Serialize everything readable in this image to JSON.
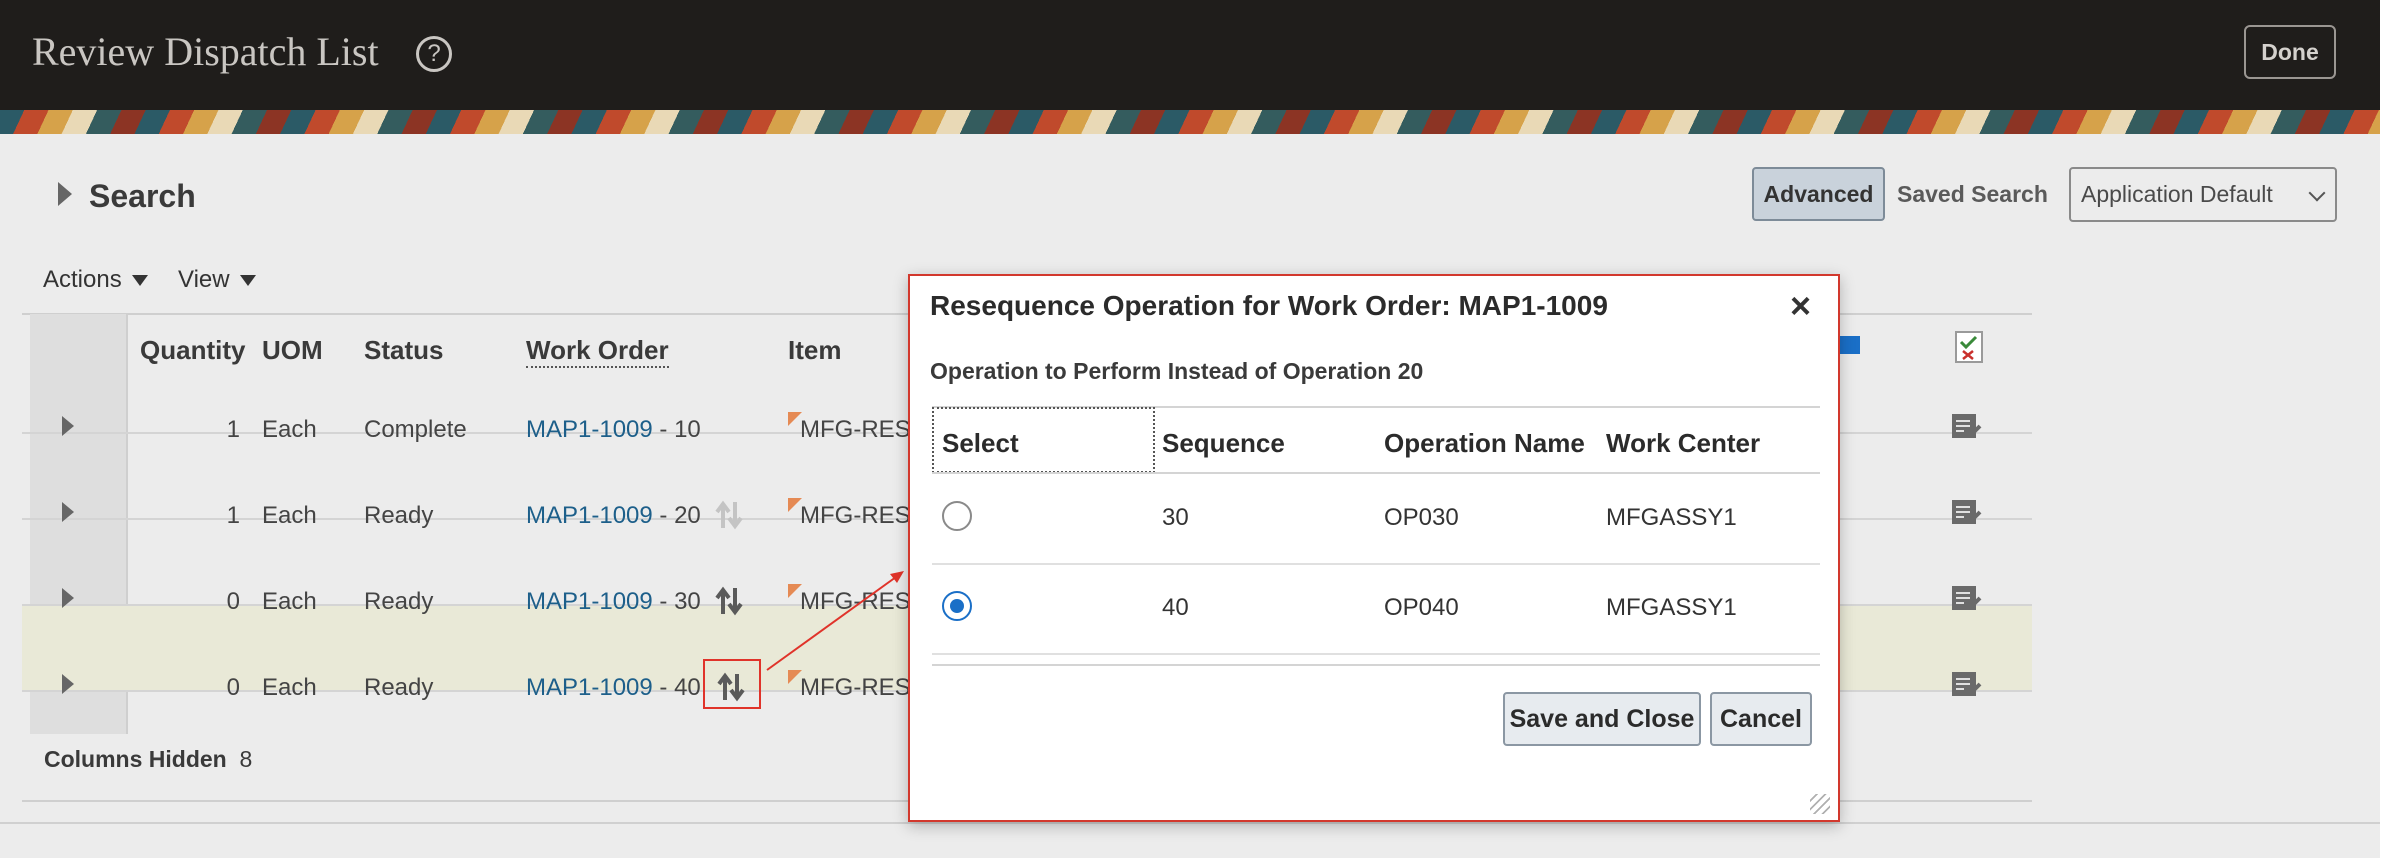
{
  "header": {
    "title": "Review Dispatch List",
    "help_icon": "?",
    "done_label": "Done"
  },
  "search": {
    "title": "Search",
    "advanced_label": "Advanced",
    "saved_search_label": "Saved Search",
    "saved_search_value": "Application Default"
  },
  "toolbar": {
    "actions_label": "Actions",
    "view_label": "View"
  },
  "table": {
    "columns": [
      "Quantity",
      "UOM",
      "Status",
      "Work Order",
      "Item"
    ],
    "rows": [
      {
        "quantity": "1",
        "uom": "Each",
        "status": "Complete",
        "work_order": "MAP1-1009",
        "op_suffix": "- 10",
        "item": "MFG-RES"
      },
      {
        "quantity": "1",
        "uom": "Each",
        "status": "Ready",
        "work_order": "MAP1-1009",
        "op_suffix": "- 20",
        "item": "MFG-RES"
      },
      {
        "quantity": "0",
        "uom": "Each",
        "status": "Ready",
        "work_order": "MAP1-1009",
        "op_suffix": "- 30",
        "item": "MFG-RES"
      },
      {
        "quantity": "0",
        "uom": "Each",
        "status": "Ready",
        "work_order": "MAP1-1009",
        "op_suffix": "- 40",
        "item": "MFG-RES"
      }
    ],
    "columns_hidden_label": "Columns Hidden",
    "columns_hidden_count": "8"
  },
  "dialog": {
    "title": "Resequence Operation for Work Order: MAP1-1009",
    "close_icon": "×",
    "subtitle": "Operation to Perform Instead of Operation 20",
    "columns": [
      "Select",
      "Sequence",
      "Operation Name",
      "Work Center"
    ],
    "rows": [
      {
        "selected": false,
        "sequence": "30",
        "operation_name": "OP030",
        "work_center": "MFGASSY1"
      },
      {
        "selected": true,
        "sequence": "40",
        "operation_name": "OP040",
        "work_center": "MFGASSY1"
      }
    ],
    "save_label": "Save and Close",
    "cancel_label": "Cancel"
  },
  "colors": {
    "header_bg": "#1f1d1b",
    "link": "#1d5f8a",
    "radio_selected": "#1a6fc7",
    "callout": "#e0332a"
  }
}
